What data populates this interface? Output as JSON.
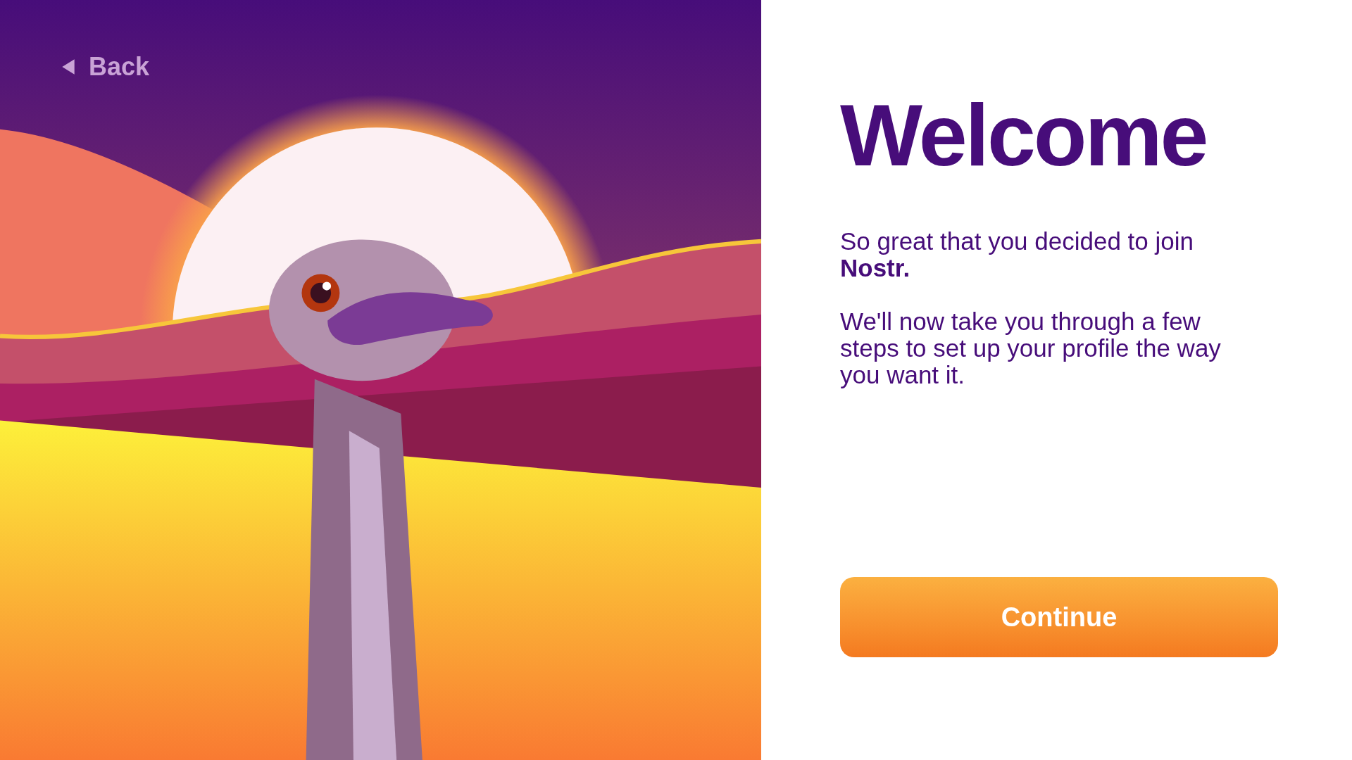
{
  "back": {
    "label": "Back"
  },
  "heading": "Welcome",
  "paragraphs": [
    "So great that you decided to join **Nostr.**",
    "We'll now take you through a few steps to set up your profile the way you want it."
  ],
  "continue_button": {
    "label": "Continue"
  }
}
